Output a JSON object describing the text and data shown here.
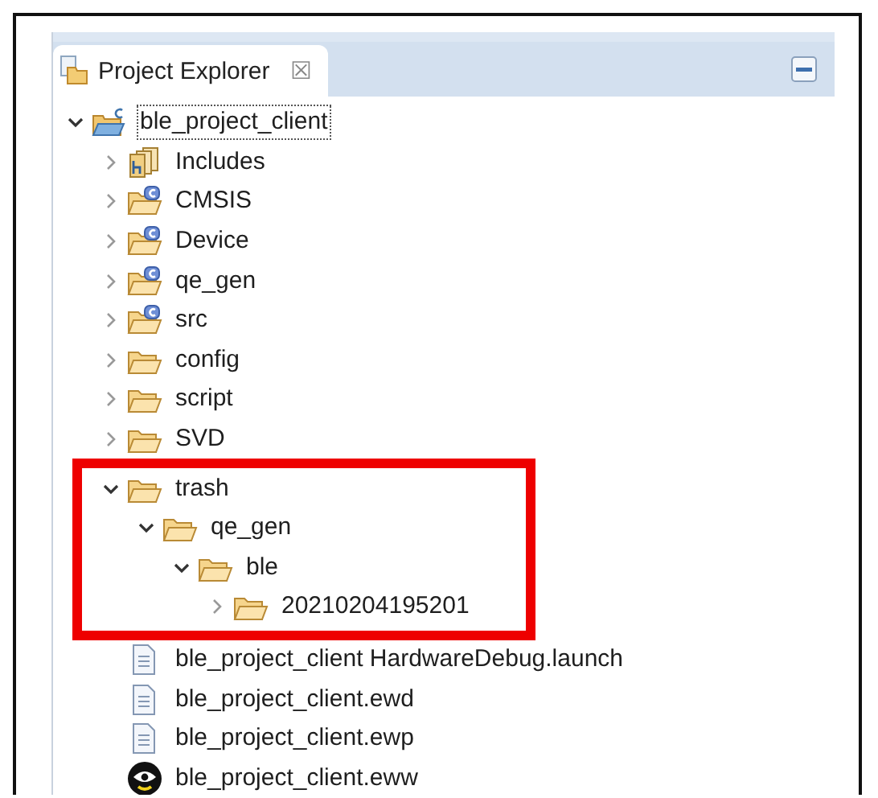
{
  "tab": {
    "label": "Project Explorer",
    "close": "☒"
  },
  "tree": [
    {
      "label": "ble_project_client",
      "kind": "project",
      "expanded": true,
      "selected": true,
      "children": [
        {
          "label": "Includes",
          "kind": "includes",
          "expanded": false,
          "selected": false
        },
        {
          "label": "CMSIS",
          "kind": "source-folder",
          "expanded": false,
          "selected": false
        },
        {
          "label": "Device",
          "kind": "source-folder",
          "expanded": false,
          "selected": false
        },
        {
          "label": "qe_gen",
          "kind": "source-folder",
          "expanded": false,
          "selected": false
        },
        {
          "label": "src",
          "kind": "source-folder",
          "expanded": false,
          "selected": false
        },
        {
          "label": "config",
          "kind": "folder",
          "expanded": false,
          "selected": false
        },
        {
          "label": "script",
          "kind": "folder",
          "expanded": false,
          "selected": false
        },
        {
          "label": "SVD",
          "kind": "folder",
          "expanded": false,
          "selected": false
        },
        {
          "label": "trash",
          "kind": "folder",
          "expanded": true,
          "selected": false,
          "highlighted": true,
          "children": [
            {
              "label": "qe_gen",
              "kind": "folder",
              "expanded": true,
              "selected": false,
              "children": [
                {
                  "label": "ble",
                  "kind": "folder",
                  "expanded": true,
                  "selected": false,
                  "children": [
                    {
                      "label": "20210204195201",
                      "kind": "folder",
                      "expanded": false,
                      "selected": false
                    }
                  ]
                }
              ]
            }
          ]
        },
        {
          "label": "ble_project_client HardwareDebug.launch",
          "kind": "file",
          "selected": false
        },
        {
          "label": "ble_project_client.ewd",
          "kind": "file",
          "selected": false
        },
        {
          "label": "ble_project_client.ewp",
          "kind": "file",
          "selected": false
        },
        {
          "label": "ble_project_client.eww",
          "kind": "workspace",
          "selected": false
        }
      ]
    }
  ]
}
